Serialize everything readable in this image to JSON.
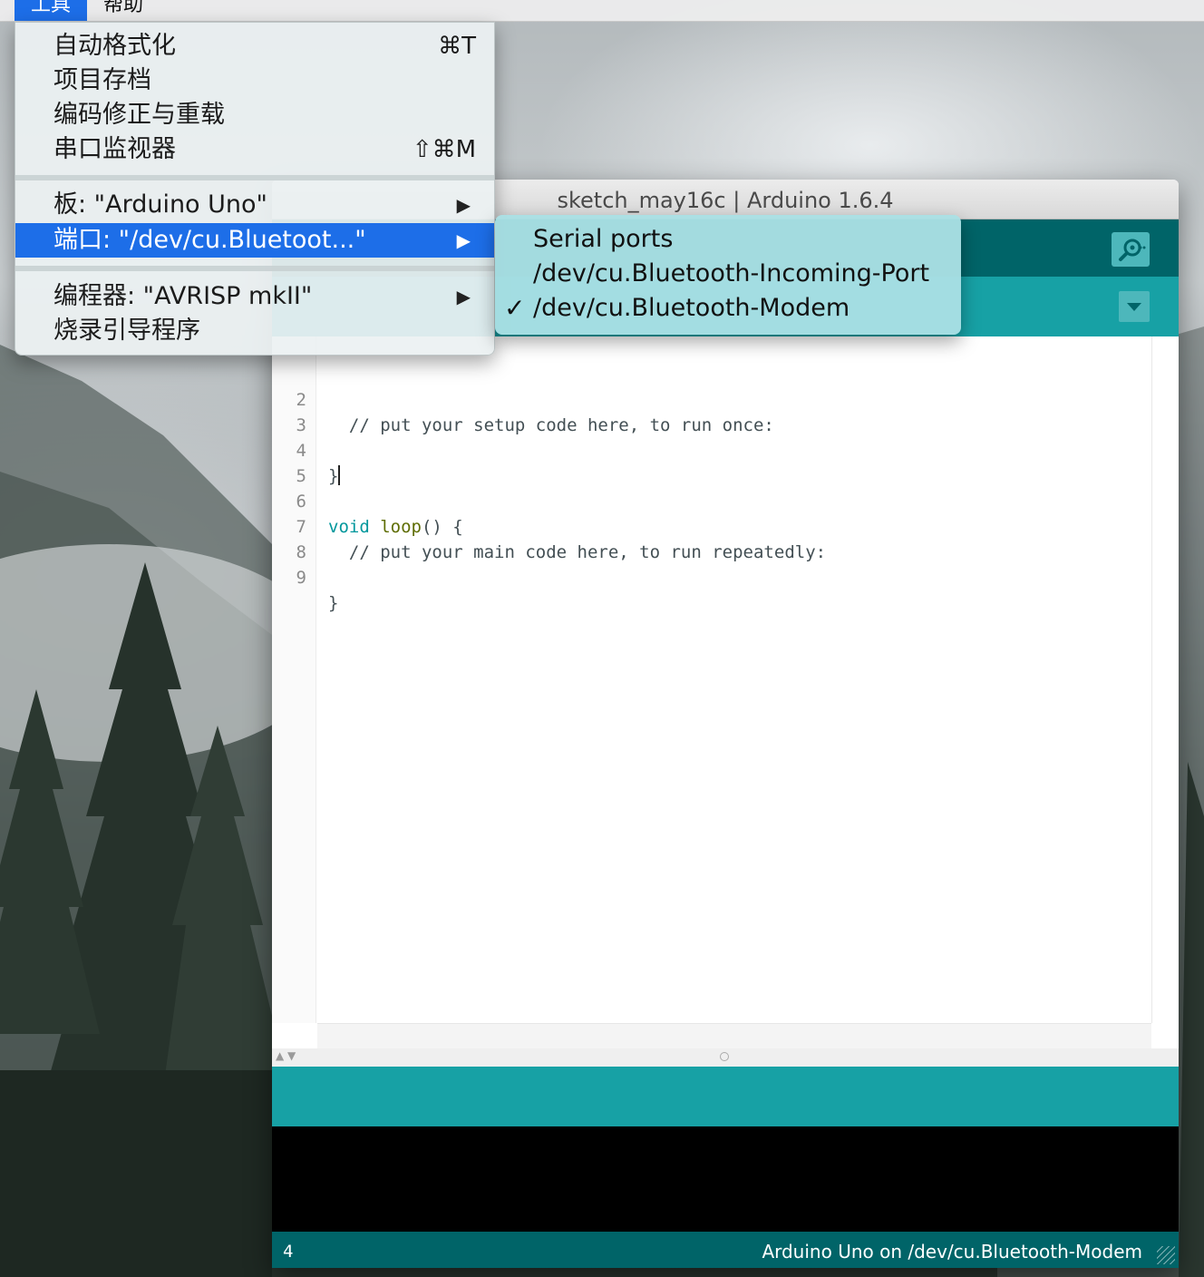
{
  "menubar": {
    "items": [
      {
        "label": "工具",
        "active": true
      },
      {
        "label": "帮助",
        "active": false
      }
    ]
  },
  "tools_menu": {
    "items": [
      {
        "label": "自动格式化",
        "shortcut": "⌘T"
      },
      {
        "label": "项目存档",
        "shortcut": ""
      },
      {
        "label": "编码修正与重载",
        "shortcut": ""
      },
      {
        "label": "串口监视器",
        "shortcut": "⇧⌘M"
      },
      {
        "label": "板: \"Arduino Uno\"",
        "submenu": true
      },
      {
        "label": "端口: \"/dev/cu.Bluetoot...\"",
        "submenu": true,
        "highlighted": true
      },
      {
        "label": "编程器: \"AVRISP mkII\"",
        "submenu": true
      },
      {
        "label": "烧录引导程序",
        "shortcut": ""
      }
    ]
  },
  "port_submenu": {
    "header": "Serial ports",
    "ports": [
      {
        "label": "/dev/cu.Bluetooth-Incoming-Port",
        "checked": false
      },
      {
        "label": "/dev/cu.Bluetooth-Modem",
        "checked": true
      }
    ],
    "check_glyph": "✓"
  },
  "window": {
    "title": "sketch_may16c | Arduino 1.6.4"
  },
  "editor": {
    "lines": [
      {
        "num": "2",
        "code": "  // put your setup code here, to run once:"
      },
      {
        "num": "3",
        "code": ""
      },
      {
        "num": "4",
        "code": "}"
      },
      {
        "num": "5",
        "code": ""
      },
      {
        "num": "6",
        "code_type": "void",
        "code_fn": "loop",
        "code_rest": "() {"
      },
      {
        "num": "7",
        "code": "  // put your main code here, to run repeatedly:"
      },
      {
        "num": "8",
        "code": ""
      },
      {
        "num": "9",
        "code": "}"
      }
    ]
  },
  "footer": {
    "line_number": "4",
    "board_info": "Arduino Uno on /dev/cu.Bluetooth-Modem"
  },
  "colors": {
    "toolbar": "#006468",
    "tabbar": "#17a1a5",
    "menu_highlight": "#1d6ee8",
    "submenu_bg": "#aae0e4"
  },
  "icons": {
    "serial_monitor": "magnifier-icon",
    "tab_menu": "chevron-down-icon",
    "submenu_arrow": "triangle-right-icon"
  }
}
